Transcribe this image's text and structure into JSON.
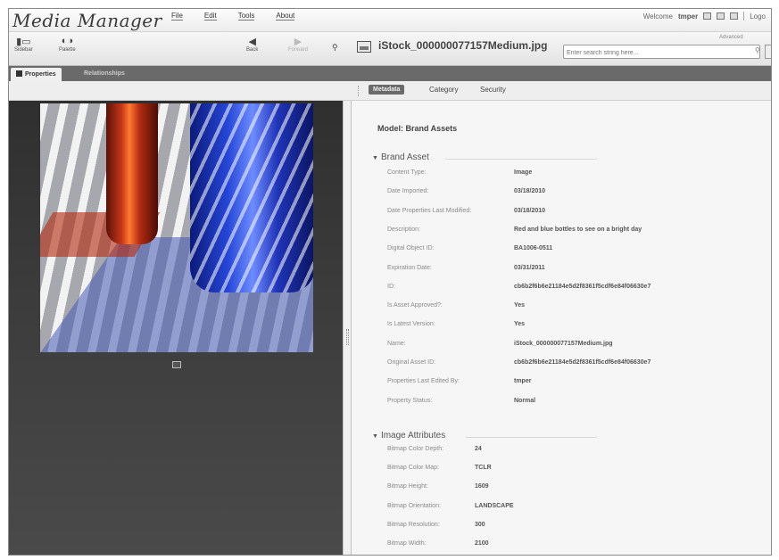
{
  "app": {
    "title": "Media Manager",
    "menu": [
      "File",
      "Edit",
      "Tools",
      "About"
    ],
    "welcome": "Welcome",
    "username": "tmper",
    "logout": "Logo"
  },
  "toolbar": {
    "sidebar_label": "Sidebar",
    "palette_label": "Palette",
    "back_label": "Back",
    "forward_label": "Forward",
    "file_name": "iStock_000000077157Medium.jpg",
    "advanced_label": "Advanced",
    "search_placeholder": "Enter search string here..."
  },
  "tabs": {
    "properties": "Properties",
    "relationships": "Relationships"
  },
  "detail_tabs": {
    "metadata": "Metadata",
    "category": "Category",
    "security": "Security"
  },
  "model": "Model: Brand Assets",
  "brand_asset": {
    "title": "Brand Asset",
    "fields": [
      {
        "label": "Content Type:",
        "value": "Image"
      },
      {
        "label": "Date Imported:",
        "value": "03/18/2010"
      },
      {
        "label": "Date Properties Last Modified:",
        "value": "03/18/2010"
      },
      {
        "label": "Description:",
        "value": "Red and blue bottles to see on a bright day"
      },
      {
        "label": "Digital Object ID:",
        "value": "BA1006-0511"
      },
      {
        "label": "Expiration Date:",
        "value": "03/31/2011"
      },
      {
        "label": "ID:",
        "value": "cb6b2f6b6e21184e5d2f8361f5cdf6e84f06630e7"
      },
      {
        "label": "Is Asset Approved?:",
        "value": "Yes"
      },
      {
        "label": "Is Latest Version:",
        "value": "Yes"
      },
      {
        "label": "Name:",
        "value": "iStock_000000077157Medium.jpg"
      },
      {
        "label": "Original Asset ID:",
        "value": "cb6b2f6b6e21184e5d2f8361f5cdf6e84f06630e7"
      },
      {
        "label": "Properties Last Edited By:",
        "value": "tmper"
      },
      {
        "label": "Property Status:",
        "value": "Normal"
      }
    ]
  },
  "image_attributes": {
    "title": "Image Attributes",
    "fields": [
      {
        "label": "Bitmap Color Depth:",
        "value": "24"
      },
      {
        "label": "Bitmap Color Map:",
        "value": "TCLR"
      },
      {
        "label": "Bitmap Height:",
        "value": "1609"
      },
      {
        "label": "Bitmap Orientation:",
        "value": "LANDSCAPE"
      },
      {
        "label": "Bitmap Resolution:",
        "value": "300"
      },
      {
        "label": "Bitmap Width:",
        "value": "2100"
      }
    ]
  }
}
